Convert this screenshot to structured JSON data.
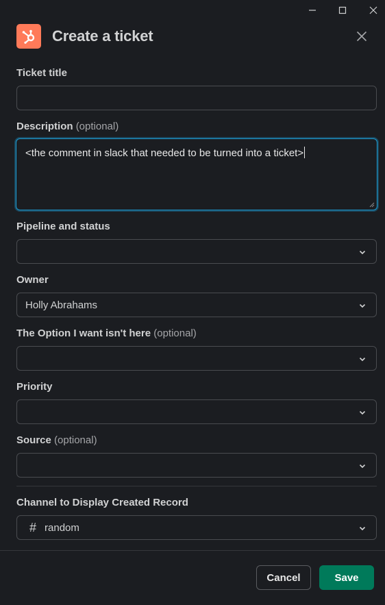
{
  "window_controls": {
    "minimize_icon": "minimize-icon",
    "maximize_icon": "maximize-icon",
    "close_icon": "close-icon"
  },
  "header": {
    "title": "Create a ticket",
    "logo_icon": "hubspot-icon",
    "logo_color": "#ff7a59"
  },
  "form": {
    "ticket_title": {
      "label": "Ticket title",
      "value": ""
    },
    "description": {
      "label": "Description",
      "optional": "(optional)",
      "value": "<the comment in slack that needed to be turned into a ticket>"
    },
    "pipeline": {
      "label": "Pipeline and status",
      "value": ""
    },
    "owner": {
      "label": "Owner",
      "value": "Holly Abrahams"
    },
    "option_missing": {
      "label": "The Option I want isn't here",
      "optional": "(optional)",
      "value": ""
    },
    "priority": {
      "label": "Priority",
      "value": ""
    },
    "source": {
      "label": "Source",
      "optional": "(optional)",
      "value": ""
    },
    "channel": {
      "label": "Channel to Display Created Record",
      "value": "random",
      "icon": "hash-icon"
    }
  },
  "footer": {
    "cancel_label": "Cancel",
    "save_label": "Save",
    "save_color": "#007a5a",
    "focus_color": "#1d9bd1"
  }
}
